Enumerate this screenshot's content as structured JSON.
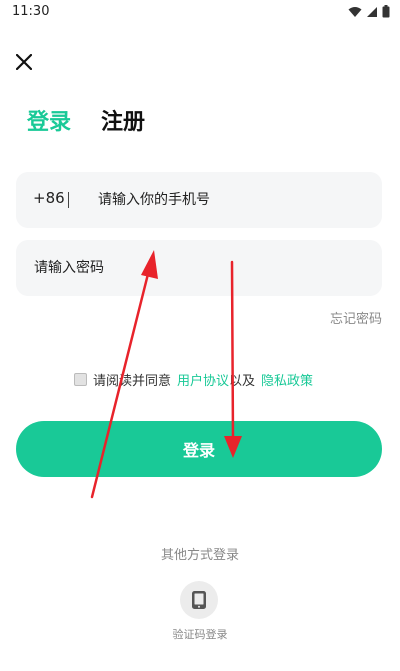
{
  "status_bar": {
    "time": "11:30"
  },
  "tabs": [
    {
      "label": "登录",
      "active": true
    },
    {
      "label": "注册",
      "active": false
    }
  ],
  "phone": {
    "country_code": "+86",
    "placeholder": "请输入你的手机号",
    "value": ""
  },
  "password": {
    "placeholder": "请输入密码",
    "value": ""
  },
  "forgot_label": "忘记密码",
  "agreement": {
    "checked": false,
    "prefix": "请阅读并同意",
    "user_agreement": "用户协议",
    "and": "以及",
    "privacy_policy": "隐私政策"
  },
  "login_button": "登录",
  "other_methods": {
    "label": "其他方式登录",
    "sms": {
      "label": "验证码登录",
      "icon": "phone-icon"
    }
  },
  "colors": {
    "accent": "#19c997",
    "field_bg": "#f5f6f7",
    "annotation": "#e8232b"
  }
}
